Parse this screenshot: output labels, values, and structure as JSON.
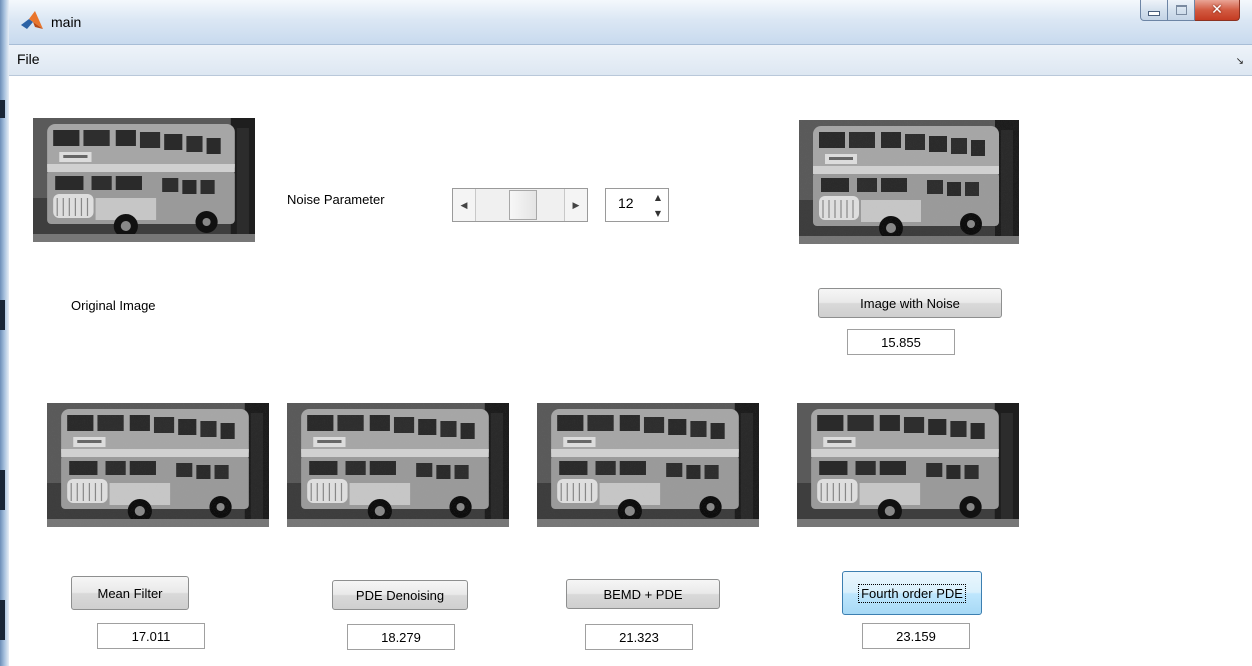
{
  "window": {
    "title": "main",
    "icon": "matlab-icon",
    "controls": [
      "minimize-icon",
      "maximize-icon",
      "close-icon"
    ]
  },
  "menu": {
    "items": [
      "File"
    ],
    "corner_icon": "dock-arrow-icon"
  },
  "original": {
    "label": "Original Image"
  },
  "noise": {
    "label": "Noise Parameter",
    "value": "12",
    "slider_level": 0.55
  },
  "noisy": {
    "button": "Image with Noise",
    "psnr": "15.855"
  },
  "filters": [
    {
      "button": "Mean Filter",
      "psnr": "17.011"
    },
    {
      "button": "PDE Denoising",
      "psnr": "18.279"
    },
    {
      "button": "BEMD + PDE",
      "psnr": "21.323"
    },
    {
      "button": "Fourth order PDE",
      "psnr": "23.159"
    }
  ],
  "colors": {
    "titlebar": "#dbe7f4",
    "close_button": "#c43b22",
    "focused_button": "#bee6fd"
  }
}
